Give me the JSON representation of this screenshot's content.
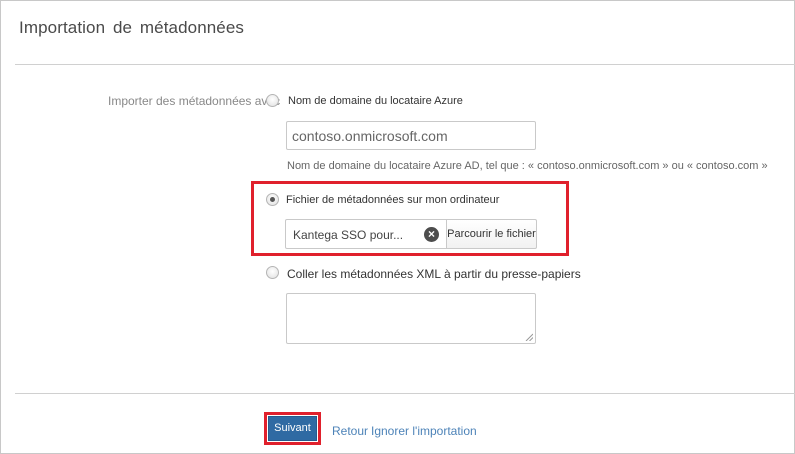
{
  "dialog": {
    "title": "Importation de métadonnées"
  },
  "import_options": {
    "label": "Importer des métadonnées avec",
    "domain": {
      "label": "Nom de domaine du locataire Azure",
      "value": "contoso.onmicrosoft.com",
      "hint": "Nom de domaine du locataire Azure AD, tel que : « contoso.onmicrosoft.com » ou « contoso.com »"
    },
    "file": {
      "label": "Fichier de métadonnées sur mon ordinateur",
      "file_name": "Kantega SSO pour...",
      "clear_glyph": "×",
      "browse_label": "Parcourir le fichier"
    },
    "xml": {
      "label": "Coller les métadonnées XML à partir du presse-papiers",
      "value": ""
    },
    "selected": "file"
  },
  "footer": {
    "next_label": "Suivant",
    "back_label": "Retour",
    "skip_label": "Ignorer l'importation"
  },
  "colors": {
    "highlight": "#e0202c",
    "primary_button": "#2f6aa3",
    "link": "#4d83b8"
  }
}
